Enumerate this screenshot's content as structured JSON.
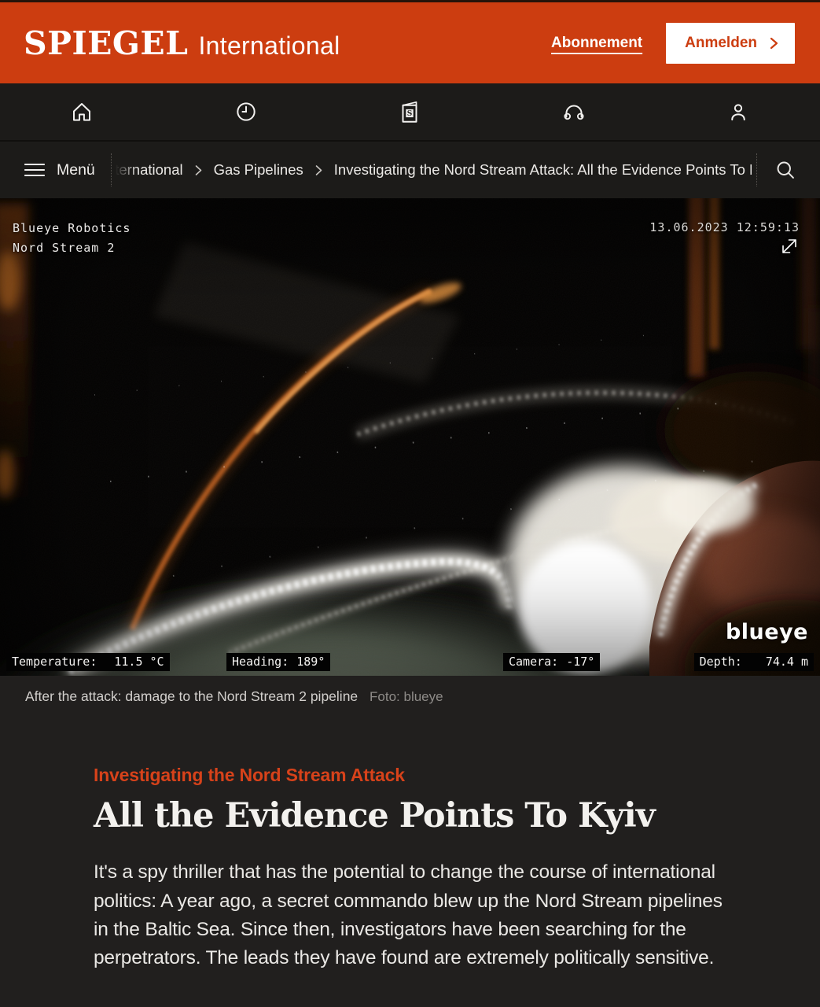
{
  "colors": {
    "accent": "#cc3d10",
    "kicker": "#d7421a",
    "page_bg": "#211f1e",
    "bar_bg": "#1c1b19"
  },
  "masthead": {
    "brand": "SPIEGEL",
    "brand_suffix": "International",
    "abonnement_label": "Abonnement",
    "anmelden_label": "Anmelden"
  },
  "icon_nav": {
    "icons": [
      "home-icon",
      "clock-icon",
      "spiegel-epaper-icon",
      "audio-icon",
      "profile-icon"
    ],
    "epaper_glyph": "S"
  },
  "breadcrumb": {
    "menu_label": "Menü",
    "items": [
      "International",
      "Gas Pipelines",
      "Investigating the Nord Stream Attack: All the Evidence Points To Kyiv"
    ]
  },
  "video": {
    "source_line1": "Blueye Robotics",
    "source_line2": "Nord Stream 2",
    "timestamp": "13.06.2023 12:59:13",
    "watermark": "blueye",
    "telemetry": [
      {
        "label": "Temperature:",
        "value": "11.5 °C"
      },
      {
        "label": "Heading:",
        "value": "189°"
      },
      {
        "label": "Camera:",
        "value": "-17°"
      },
      {
        "label": "Depth:",
        "value": "74.4 m"
      }
    ]
  },
  "caption": {
    "text": "After the attack: damage to the Nord Stream 2 pipeline",
    "credit": "Foto: blueye"
  },
  "article": {
    "kicker": "Investigating the Nord Stream Attack",
    "title": "All the Evidence Points To Kyiv",
    "intro": "It's a spy thriller that has the potential to change the course of international politics: A year ago, a secret commando blew up the Nord Stream pipelines in the Baltic Sea. Since then, investigators have been searching for the perpetrators. The leads they have found are extremely politically sensitive."
  }
}
